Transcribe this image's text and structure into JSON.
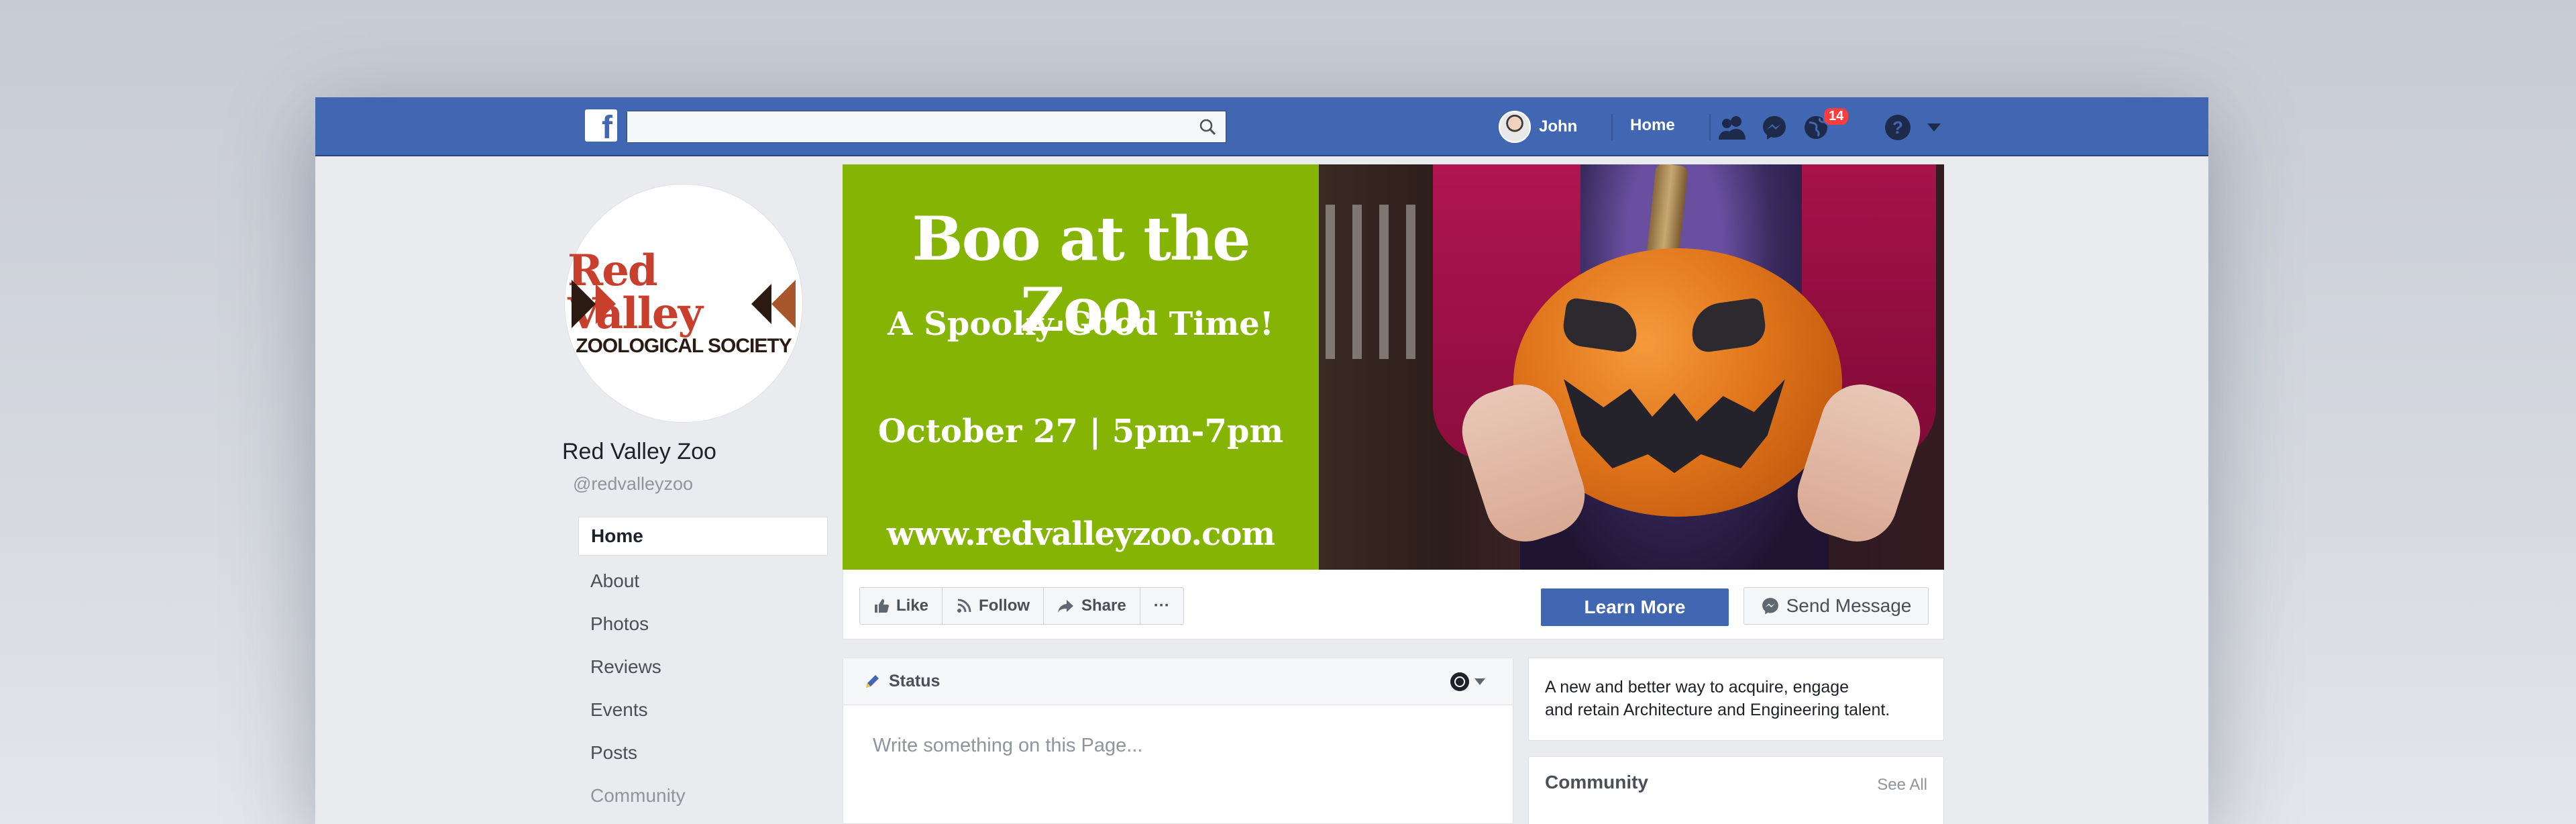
{
  "topbar": {
    "search_placeholder": "",
    "user_name": "John",
    "home_label": "Home",
    "notification_count": "14",
    "brand_color": "#4267b2"
  },
  "profile": {
    "logo_line1": "Red Valley",
    "logo_line2": "ZOOLOGICAL SOCIETY",
    "name": "Red Valley Zoo",
    "handle": "@redvalleyzoo"
  },
  "sidebar": {
    "items": [
      {
        "label": "Home"
      },
      {
        "label": "About"
      },
      {
        "label": "Photos"
      },
      {
        "label": "Reviews"
      },
      {
        "label": "Events"
      },
      {
        "label": "Posts"
      },
      {
        "label": "Community"
      }
    ]
  },
  "cover": {
    "title": "Boo at the Zoo",
    "subtitle": "A Spooky Good Time!",
    "date": "October 27 | 5pm-7pm",
    "url": "www.redvalleyzoo.com",
    "panel_color": "#86b404"
  },
  "actions": {
    "like": "Like",
    "follow": "Follow",
    "share": "Share",
    "more": "···",
    "learn_more": "Learn More",
    "send_message": "Send Message"
  },
  "status": {
    "label": "Status",
    "placeholder": "Write something on this Page..."
  },
  "promo": {
    "line1": "A new and better way to acquire, engage",
    "line2": "and retain Architecture and Engineering talent."
  },
  "community": {
    "title": "Community",
    "see_all": "See All"
  }
}
